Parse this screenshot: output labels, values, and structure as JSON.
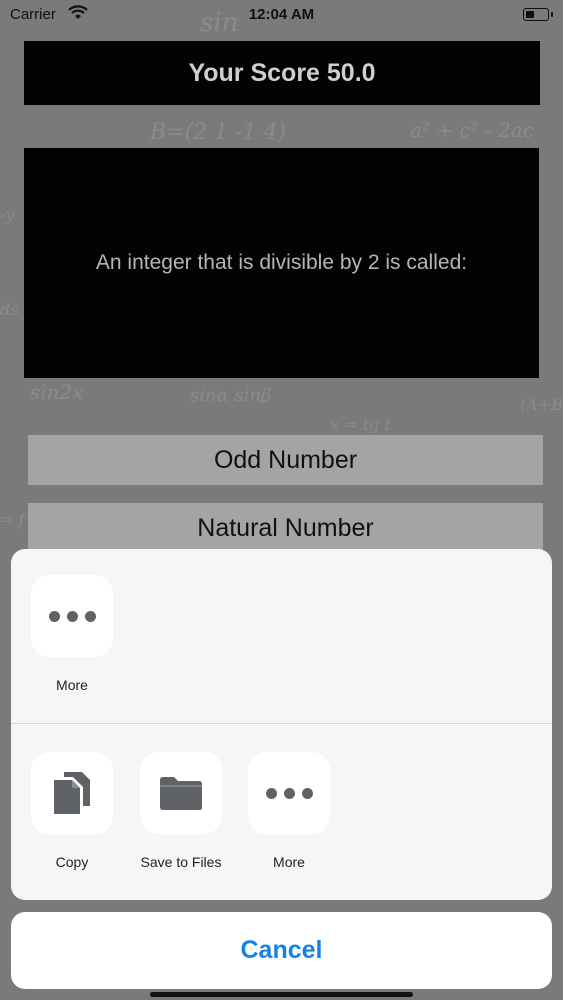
{
  "status_bar": {
    "carrier": "Carrier",
    "time": "12:04 AM",
    "battery_level": 0.4
  },
  "quiz": {
    "score_label": "Your Score 50.0",
    "question": "An integer that is divisible by 2 is called:",
    "answers": [
      "Odd Number",
      "Natural Number"
    ]
  },
  "share_sheet": {
    "top_row": [
      {
        "label": "More",
        "icon": "more-dots-icon"
      }
    ],
    "actions": [
      {
        "label": "Copy",
        "icon": "copy-icon"
      },
      {
        "label": "Save to Files",
        "icon": "folder-icon"
      },
      {
        "label": "More",
        "icon": "more-dots-icon"
      }
    ],
    "cancel_label": "Cancel"
  },
  "colors": {
    "cancel_text": "#1682e6",
    "score_background": "#030303",
    "answer_background": "#a4a4a4"
  }
}
